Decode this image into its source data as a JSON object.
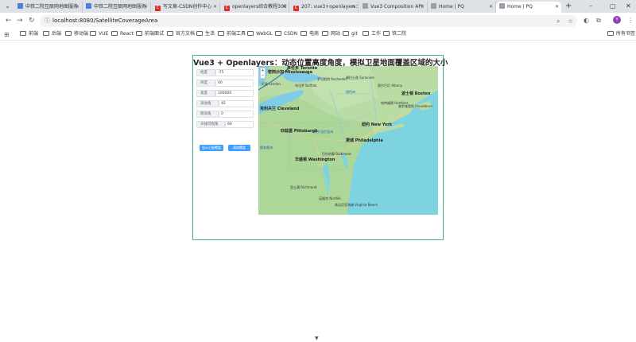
{
  "browser": {
    "tabs": [
      {
        "title": "中铁二院互联网地图服务",
        "favicon": "blue"
      },
      {
        "title": "中铁二院互联网地图服务",
        "favicon": "blue"
      },
      {
        "title": "写文章-CSDN创作中心",
        "favicon": "red",
        "letter": "C"
      },
      {
        "title": "openlayers综合教程300",
        "favicon": "red",
        "letter": "C"
      },
      {
        "title": "207: vue3+openlayers：",
        "favicon": "red",
        "letter": "C"
      },
      {
        "title": "Vue3 Composition API",
        "favicon": "grey"
      },
      {
        "title": "Home | PQ",
        "favicon": "grey"
      },
      {
        "title": "Home | PQ",
        "favicon": "grey"
      }
    ],
    "url": "localhost:8080/SatelliteCoverageArea",
    "bookmarks": [
      "前端",
      "后端",
      "移动端",
      "VUE",
      "React",
      "前端面试",
      "官方文档",
      "生活",
      "前端工具",
      "WebGL",
      "CSDN",
      "电商",
      "网站",
      "git",
      "工作",
      "铁二院"
    ],
    "all_bookmarks": "所有书签",
    "profile_letter": "Y"
  },
  "app": {
    "title": "Vue3 + Openlayers：动态位置高度角度，模拟卫星地面覆盖区域的大小",
    "fields": [
      {
        "label": "经度",
        "value": "-75"
      },
      {
        "label": "纬度",
        "value": "40"
      },
      {
        "label": "高度",
        "value": "100000"
      },
      {
        "label": "滚动角",
        "value": "45"
      },
      {
        "label": "俯仰角",
        "value": "0"
      },
      {
        "label": "天线可视角",
        "value": "60"
      }
    ],
    "buttons": {
      "show": "显示卫星覆盖",
      "clear": "清除覆盖"
    }
  },
  "map": {
    "zoom_in": "+",
    "zoom_out": "−",
    "places": [
      {
        "name": "多伦多",
        "sub": "Toronto"
      },
      {
        "name": "布法罗",
        "sub": "Buffalo"
      },
      {
        "name": "伦敦",
        "sub": "London"
      },
      {
        "name": "密西沙加",
        "sub": "Mississauga"
      },
      {
        "name": "罗切斯特",
        "sub": "Rochester"
      },
      {
        "name": "锡拉丘兹",
        "sub": "Syracuse"
      },
      {
        "name": "奥尔巴尼",
        "sub": "Albany"
      },
      {
        "name": "波士顿",
        "sub": "Boston"
      },
      {
        "name": "哈特福德",
        "sub": "Hartford"
      },
      {
        "name": "普罗维登斯",
        "sub": "Providence"
      },
      {
        "name": "克利夫兰",
        "sub": "Cleveland"
      },
      {
        "name": "匹兹堡",
        "sub": "Pittsburgh"
      },
      {
        "name": "纽约",
        "sub": "New York"
      },
      {
        "name": "费城",
        "sub": "Philadelphia"
      },
      {
        "name": "华盛顿",
        "sub": "Washington"
      },
      {
        "name": "巴尔的摩",
        "sub": "Baltimore"
      },
      {
        "name": "里士满",
        "sub": "Richmond"
      },
      {
        "name": "诺福克",
        "sub": "Norfolk"
      },
      {
        "name": "弗吉尼亚海滩",
        "sub": "Virginia Beach"
      },
      {
        "name": "宾夕法尼亚州",
        "sub": ""
      },
      {
        "name": "纽约州",
        "sub": ""
      },
      {
        "name": "俄亥俄州",
        "sub": ""
      }
    ]
  }
}
